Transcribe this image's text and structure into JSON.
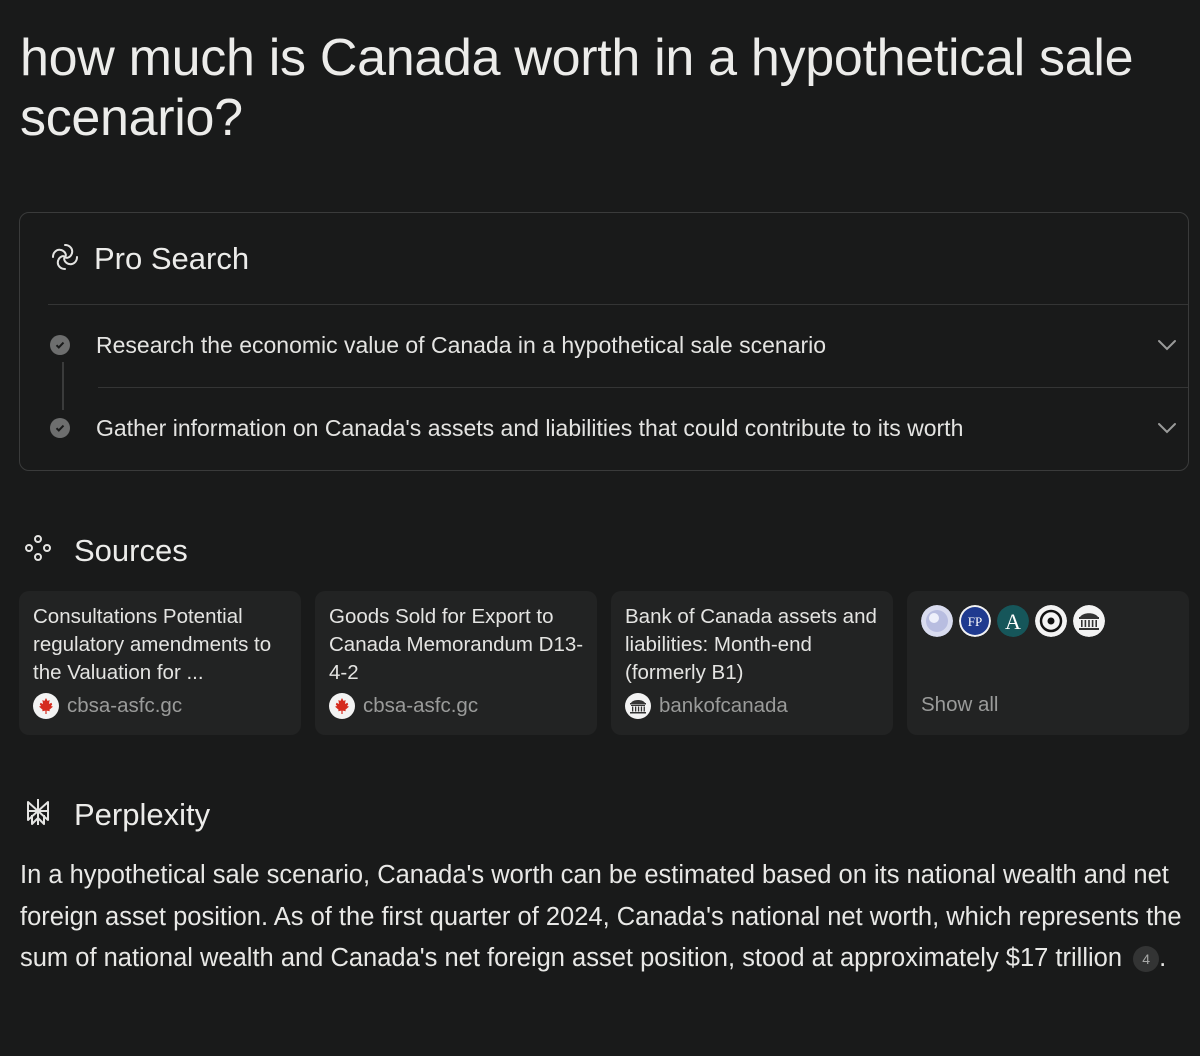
{
  "query": "how much is Canada worth in a hypothetical sale scenario?",
  "pro_search": {
    "title": "Pro Search",
    "icon": "pro-search-spiral-icon",
    "steps": [
      {
        "label": "Research the economic value of Canada in a hypothetical sale scenario"
      },
      {
        "label": "Gather information on Canada's assets and liabilities that could contribute to its worth"
      }
    ]
  },
  "sources": {
    "title": "Sources",
    "icon": "sources-dots-icon",
    "items": [
      {
        "title": "Consultations Potential regulatory amendments to the Valuation for ...",
        "site": "cbsa-asfc.gc",
        "favicon": "maple-leaf-icon"
      },
      {
        "title": "Goods Sold for Export to Canada Memorandum D13-4-2",
        "site": "cbsa-asfc.gc",
        "favicon": "maple-leaf-icon"
      },
      {
        "title": "Bank of Canada assets and liabilities: Month-end (formerly B1)",
        "site": "bankofcanada",
        "favicon": "bank-building-icon"
      }
    ],
    "show_all": "Show all",
    "more_favicons": [
      "globe-icon",
      "fp-icon",
      "a-icon",
      "circle-target-icon",
      "bank-building-icon"
    ]
  },
  "answer": {
    "title": "Perplexity",
    "icon": "perplexity-logo-icon",
    "text": "In a hypothetical sale scenario, Canada's worth can be estimated based on its national wealth and net foreign asset position. As of the first quarter of 2024, Canada's national net worth, which represents the sum of national wealth and Canada's net foreign asset position, stood at approximately $17 trillion",
    "citation": "4",
    "trailing": "."
  },
  "colors": {
    "background": "#191a1a",
    "card": "#222323",
    "border": "#3a3b3b",
    "text": "#e8e8e6",
    "muted": "#9a9b9a"
  }
}
